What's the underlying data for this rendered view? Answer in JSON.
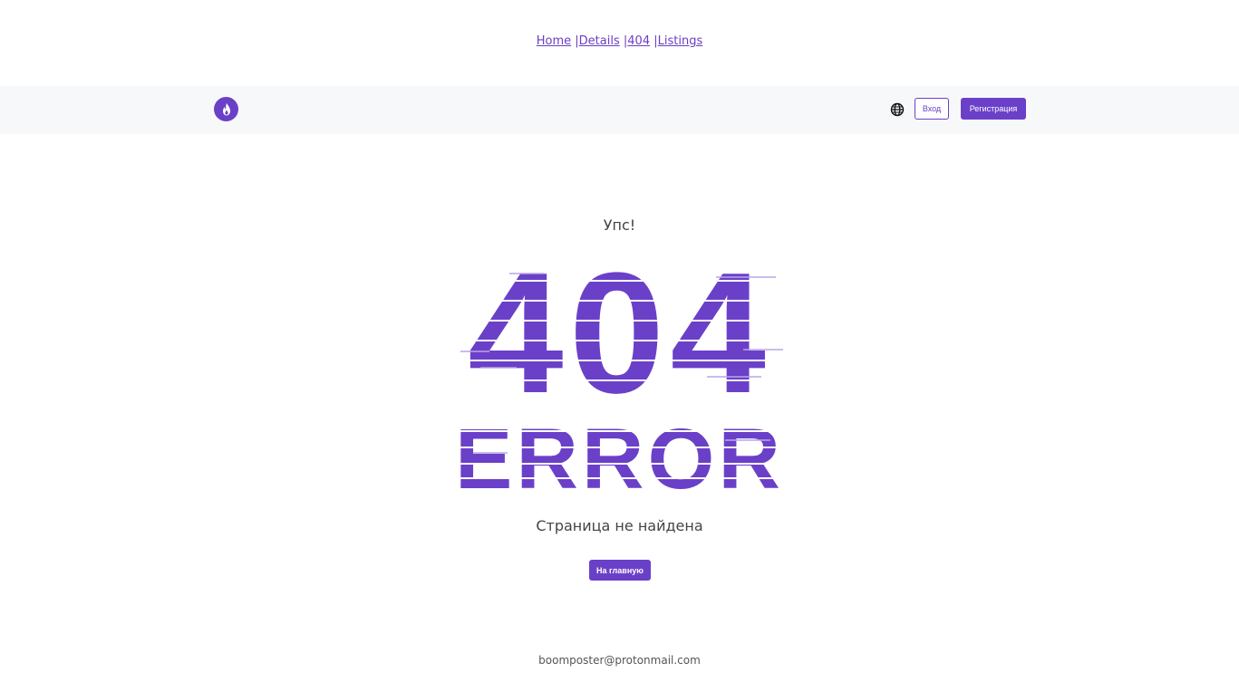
{
  "breadcrumb": {
    "items": [
      "Home",
      "Details",
      "404",
      "Listings"
    ],
    "separator": "|"
  },
  "header": {
    "logo_icon": "flame-icon",
    "language_icon": "globe-icon",
    "login_label": "Вход",
    "register_label": "Регистрация"
  },
  "main": {
    "greeting": "Упс!",
    "code": "404",
    "error_word": "ERROR",
    "message": "Страница не найдена",
    "home_button_label": "На главную"
  },
  "footer": {
    "email": "boomposter@protonmail.com"
  },
  "colors": {
    "accent": "#6b40c8",
    "header_bg": "#f7f8fa"
  }
}
